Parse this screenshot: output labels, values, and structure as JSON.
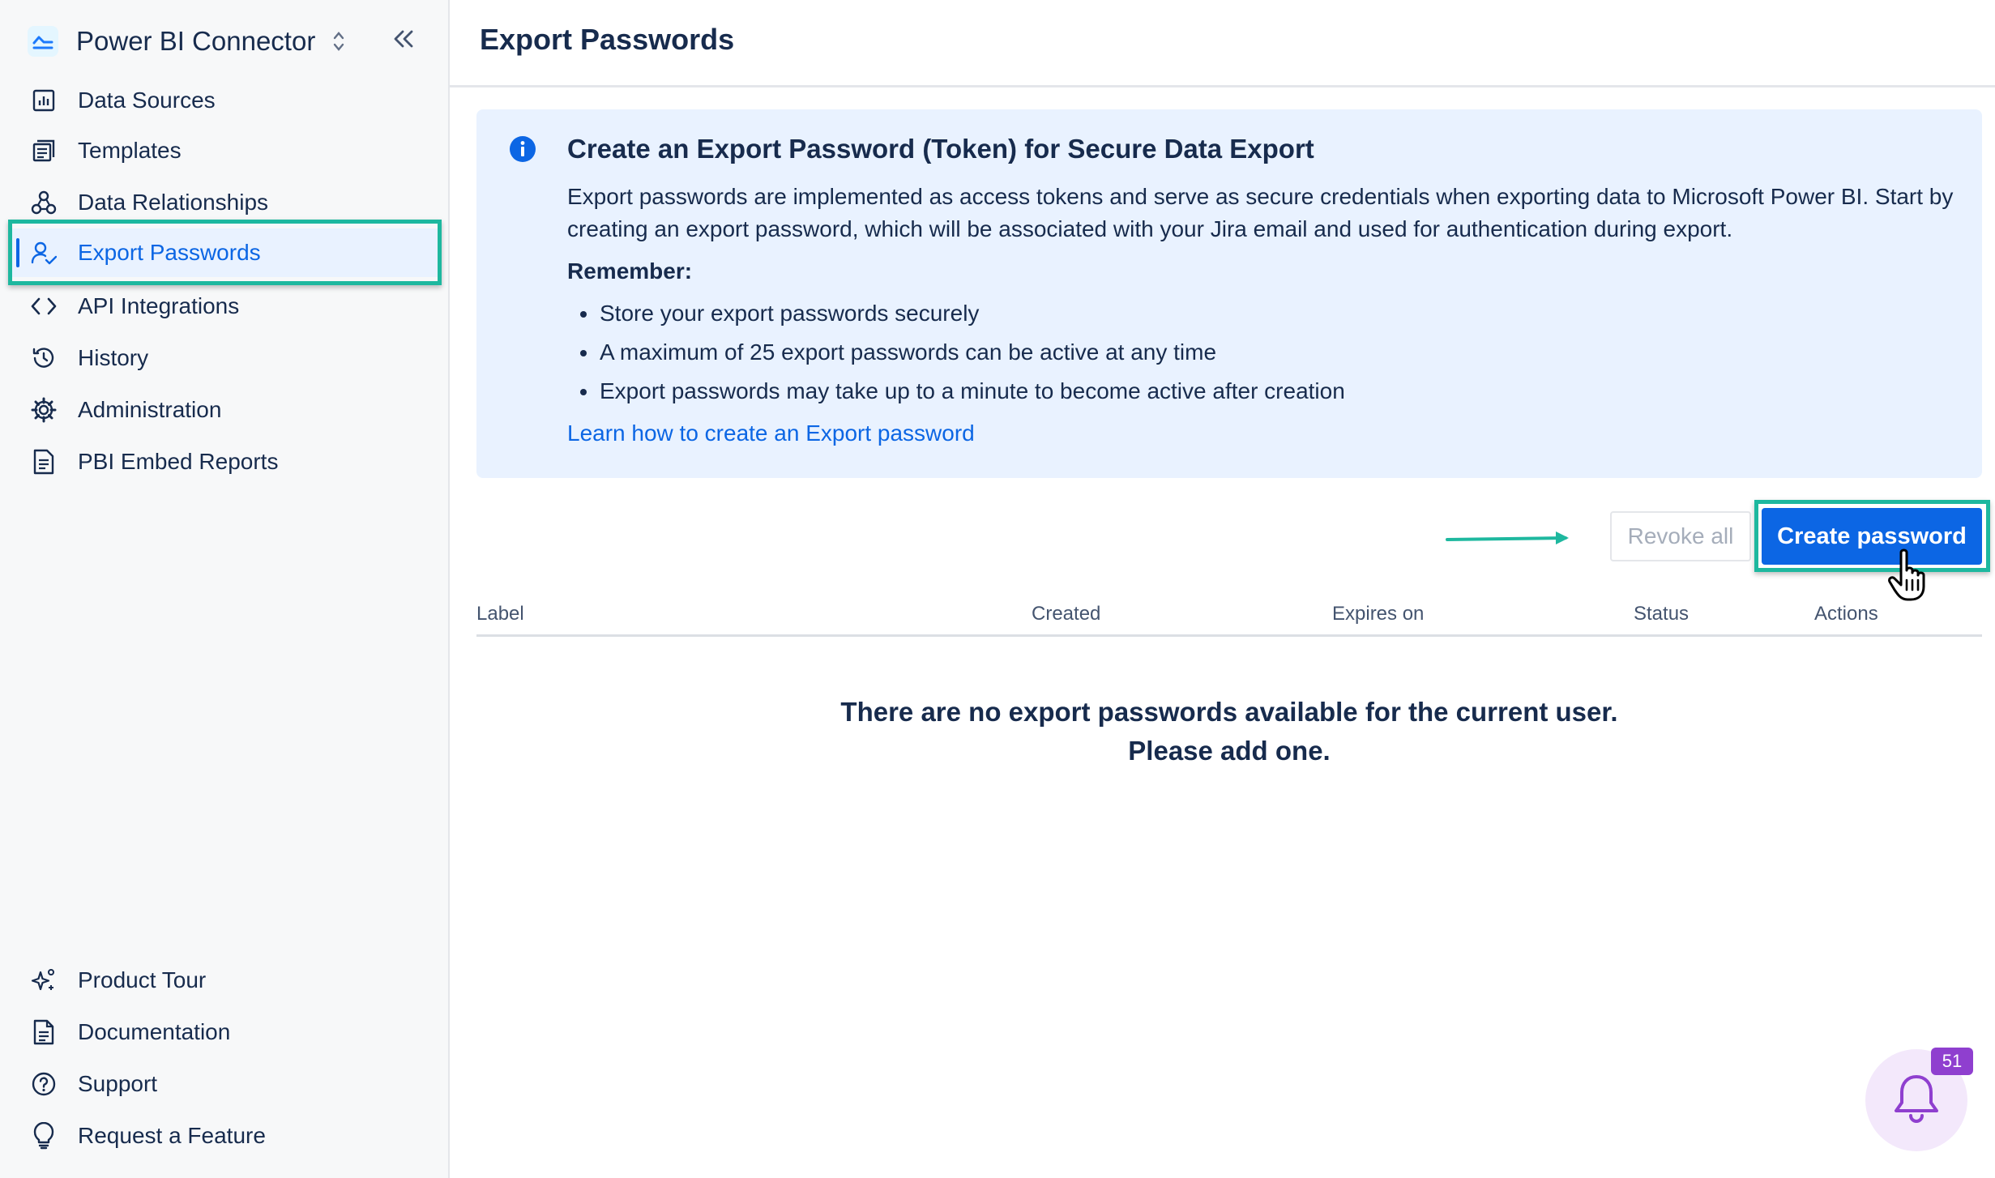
{
  "app": {
    "name": "Power BI Connector"
  },
  "sidebar": {
    "items": [
      {
        "label": "Data Sources",
        "icon": "chart-icon"
      },
      {
        "label": "Templates",
        "icon": "templates-icon"
      },
      {
        "label": "Data Relationships",
        "icon": "relationships-icon"
      },
      {
        "label": "Export Passwords",
        "icon": "user-check-icon",
        "active": true
      },
      {
        "label": "API Integrations",
        "icon": "code-icon"
      },
      {
        "label": "History",
        "icon": "history-icon"
      },
      {
        "label": "Administration",
        "icon": "gear-icon"
      },
      {
        "label": "PBI Embed Reports",
        "icon": "report-icon"
      }
    ],
    "bottom_items": [
      {
        "label": "Product Tour",
        "icon": "sparkle-icon"
      },
      {
        "label": "Documentation",
        "icon": "document-icon"
      },
      {
        "label": "Support",
        "icon": "help-icon"
      },
      {
        "label": "Request a Feature",
        "icon": "lightbulb-icon"
      }
    ]
  },
  "header": {
    "title": "Export Passwords"
  },
  "info": {
    "title": "Create an Export Password (Token) for Secure Data Export",
    "body": "Export passwords are implemented as access tokens and serve as secure credentials when exporting data to Microsoft Power BI. Start by creating an export password, which will be associated with your Jira email and used for authentication during export.",
    "remember_label": "Remember:",
    "bullets": [
      "Store your export passwords securely",
      "A maximum of 25 export passwords can be active at any time",
      "Export passwords may take up to a minute to become active after creation"
    ],
    "link": "Learn how to create an Export password"
  },
  "actions": {
    "revoke_all": "Revoke all",
    "create_password": "Create password"
  },
  "table": {
    "columns": [
      "Label",
      "Created",
      "Expires on",
      "Status",
      "Actions"
    ],
    "empty_message": "There are no export passwords available for the current user. Please add one."
  },
  "notifications": {
    "count": "51"
  },
  "colors": {
    "accent": "#0c66e4",
    "highlight": "#1eb89f",
    "info_bg": "#e9f2ff",
    "notification": "#8f3fcf"
  }
}
